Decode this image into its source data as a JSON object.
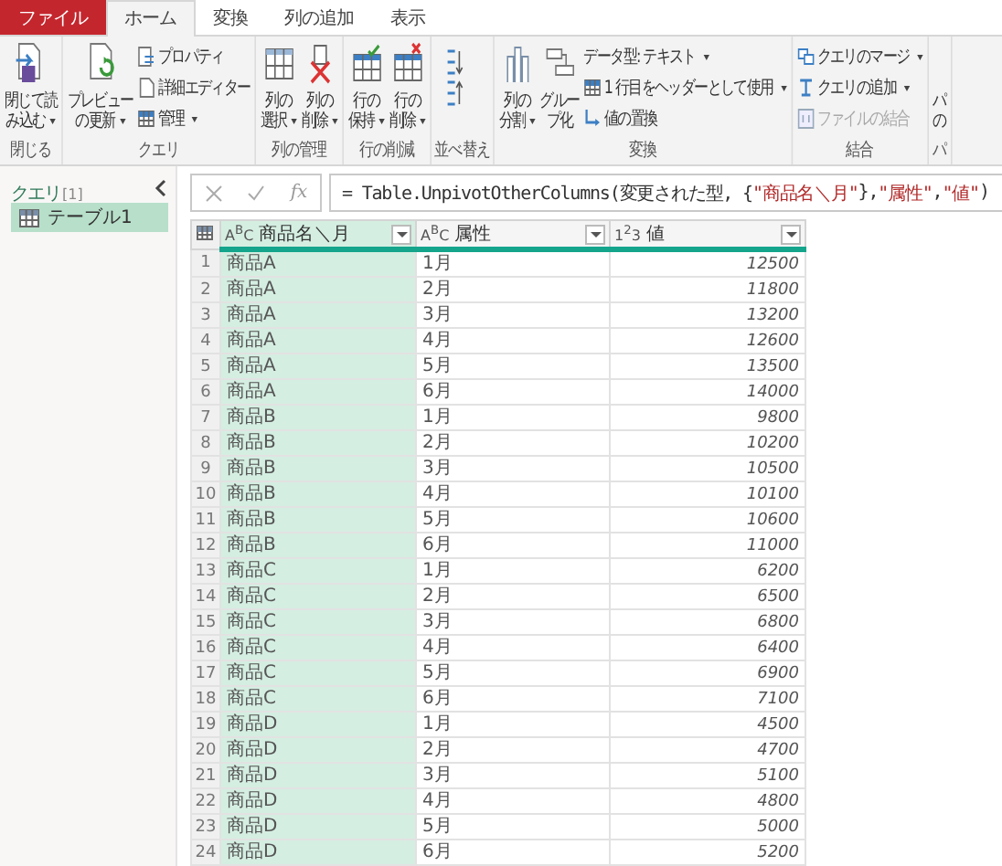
{
  "ribbon_tabs": [
    {
      "label": "ファイル",
      "kind": "file",
      "selected": false
    },
    {
      "label": "ホーム",
      "kind": "tab",
      "selected": true
    },
    {
      "label": "変換",
      "kind": "tab",
      "selected": false
    },
    {
      "label": "列の追加",
      "kind": "tab",
      "selected": false
    },
    {
      "label": "表示",
      "kind": "tab",
      "selected": false
    }
  ],
  "ribbon_groups": [
    {
      "label": "閉じる",
      "items": [
        {
          "kind": "large",
          "lines": [
            "閉じて読",
            "み込む"
          ],
          "dropdown": true
        }
      ]
    },
    {
      "label": "クエリ",
      "items": [
        {
          "kind": "large",
          "lines": [
            "プレビュー",
            "の更新"
          ],
          "dropdown": true
        },
        {
          "kind": "stack",
          "buttons": [
            {
              "label": "プロパティ",
              "dropdown": false,
              "disabled": false
            },
            {
              "label": "詳細エディター",
              "dropdown": false,
              "disabled": false
            },
            {
              "label": "管理",
              "dropdown": true,
              "disabled": false
            }
          ]
        }
      ]
    },
    {
      "label": "列の管理",
      "items": [
        {
          "kind": "large",
          "lines": [
            "列の",
            "選択"
          ],
          "dropdown": true
        },
        {
          "kind": "large",
          "lines": [
            "列の",
            "削除"
          ],
          "dropdown": true
        }
      ]
    },
    {
      "label": "行の削減",
      "items": [
        {
          "kind": "large",
          "lines": [
            "行の",
            "保持"
          ],
          "dropdown": true
        },
        {
          "kind": "large",
          "lines": [
            "行の",
            "削除"
          ],
          "dropdown": true
        }
      ]
    },
    {
      "label": "並べ替え",
      "items": [
        {
          "kind": "sort"
        }
      ]
    },
    {
      "label": "変換",
      "items": [
        {
          "kind": "large",
          "lines": [
            "列の",
            "分割"
          ],
          "dropdown": true
        },
        {
          "kind": "large",
          "lines": [
            "グルー",
            "プ化"
          ],
          "dropdown": false
        },
        {
          "kind": "stack",
          "buttons": [
            {
              "label": "データ型: テキスト",
              "dropdown": true,
              "disabled": false
            },
            {
              "label": "1 行目をヘッダーとして使用",
              "dropdown": true,
              "disabled": false
            },
            {
              "label": "値の置換",
              "dropdown": false,
              "disabled": false
            }
          ]
        }
      ]
    },
    {
      "label": "結合",
      "items": [
        {
          "kind": "stack",
          "buttons": [
            {
              "label": "クエリのマージ",
              "dropdown": true,
              "disabled": false
            },
            {
              "label": "クエリの追加",
              "dropdown": true,
              "disabled": false
            },
            {
              "label": "ファイルの結合",
              "dropdown": false,
              "disabled": true
            }
          ]
        }
      ]
    },
    {
      "label": "パ",
      "items": [
        {
          "kind": "large",
          "lines": [
            "パ",
            "の"
          ],
          "dropdown": false
        }
      ]
    }
  ],
  "query_panel": {
    "title": "クエリ",
    "count": "[1]",
    "items": [
      {
        "label": "テーブル1",
        "selected": true
      }
    ]
  },
  "formula_bar": {
    "fx_label": "fx",
    "segments": [
      {
        "kind": "code",
        "text": "= Table.UnpivotOtherColumns(変更された型, {"
      },
      {
        "kind": "string",
        "text": "\"商品名＼月\""
      },
      {
        "kind": "code",
        "text": "}, "
      },
      {
        "kind": "string",
        "text": "\"属性\""
      },
      {
        "kind": "code",
        "text": ", "
      },
      {
        "kind": "string",
        "text": "\"値\""
      },
      {
        "kind": "code",
        "text": ")"
      }
    ]
  },
  "table": {
    "columns": [
      {
        "type": "A$^{B}$C",
        "name": "商品名＼月",
        "kind": "text",
        "selected": true
      },
      {
        "type": "A$^{B}$C",
        "name": "属性",
        "kind": "text",
        "selected": false
      },
      {
        "type": "1$^{2}$3",
        "name": "値",
        "kind": "number",
        "selected": false
      }
    ],
    "rows": [
      {
        "n": "1",
        "cells": [
          "商品A",
          "1月",
          "12500"
        ]
      },
      {
        "n": "2",
        "cells": [
          "商品A",
          "2月",
          "11800"
        ]
      },
      {
        "n": "3",
        "cells": [
          "商品A",
          "3月",
          "13200"
        ]
      },
      {
        "n": "4",
        "cells": [
          "商品A",
          "4月",
          "12600"
        ]
      },
      {
        "n": "5",
        "cells": [
          "商品A",
          "5月",
          "13500"
        ]
      },
      {
        "n": "6",
        "cells": [
          "商品A",
          "6月",
          "14000"
        ]
      },
      {
        "n": "7",
        "cells": [
          "商品B",
          "1月",
          "9800"
        ]
      },
      {
        "n": "8",
        "cells": [
          "商品B",
          "2月",
          "10200"
        ]
      },
      {
        "n": "9",
        "cells": [
          "商品B",
          "3月",
          "10500"
        ]
      },
      {
        "n": "10",
        "cells": [
          "商品B",
          "4月",
          "10100"
        ]
      },
      {
        "n": "11",
        "cells": [
          "商品B",
          "5月",
          "10600"
        ]
      },
      {
        "n": "12",
        "cells": [
          "商品B",
          "6月",
          "11000"
        ]
      },
      {
        "n": "13",
        "cells": [
          "商品C",
          "1月",
          "6200"
        ]
      },
      {
        "n": "14",
        "cells": [
          "商品C",
          "2月",
          "6500"
        ]
      },
      {
        "n": "15",
        "cells": [
          "商品C",
          "3月",
          "6800"
        ]
      },
      {
        "n": "16",
        "cells": [
          "商品C",
          "4月",
          "6400"
        ]
      },
      {
        "n": "17",
        "cells": [
          "商品C",
          "5月",
          "6900"
        ]
      },
      {
        "n": "18",
        "cells": [
          "商品C",
          "6月",
          "7100"
        ]
      },
      {
        "n": "19",
        "cells": [
          "商品D",
          "1月",
          "4500"
        ]
      },
      {
        "n": "20",
        "cells": [
          "商品D",
          "2月",
          "4700"
        ]
      },
      {
        "n": "21",
        "cells": [
          "商品D",
          "3月",
          "5100"
        ]
      },
      {
        "n": "22",
        "cells": [
          "商品D",
          "4月",
          "4800"
        ]
      },
      {
        "n": "23",
        "cells": [
          "商品D",
          "5月",
          "5000"
        ]
      },
      {
        "n": "24",
        "cells": [
          "商品D",
          "6月",
          "5200"
        ]
      }
    ]
  }
}
